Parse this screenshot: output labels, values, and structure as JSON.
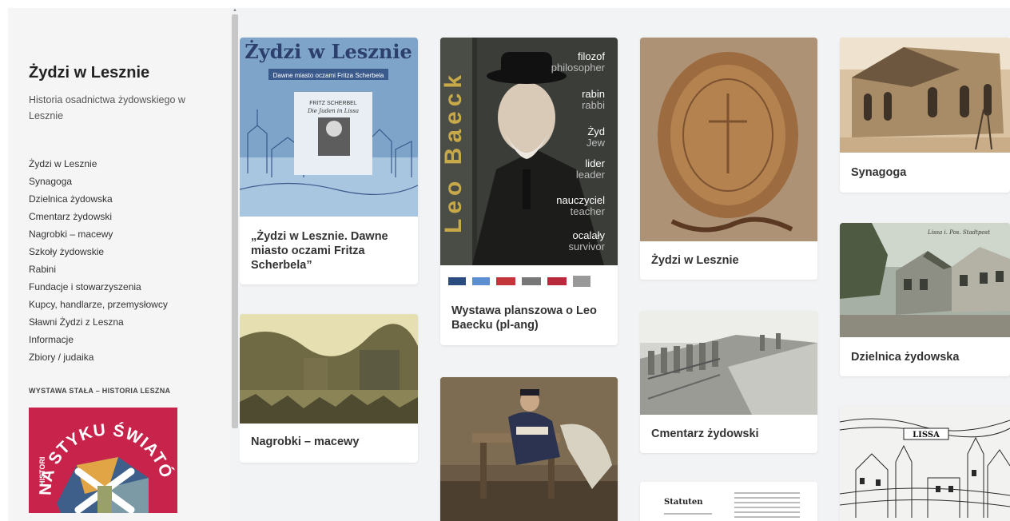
{
  "sidebar": {
    "title": "Żydzi w Lesznie",
    "description": "Historia osadnictwa żydowskiego w Lesznie",
    "nav": [
      "Żydzi w Lesznie",
      "Synagoga",
      "Dzielnica żydowska",
      "Cmentarz żydowski",
      "Nagrobki – macewy",
      "Szkoły żydowskie",
      "Rabini",
      "Fundacje i stowarzyszenia",
      "Kupcy, handlarze, przemysłowcy",
      "Sławni Żydzi z Leszna",
      "Informacje",
      "Zbiory / judaika"
    ],
    "section_label": "WYSTAWA STAŁA – HISTORIA LESZNA",
    "promo_text": "NA STYKU ŚWIATÓW",
    "promo_side_text": "HISTORI",
    "promo_color": "#c8234b"
  },
  "cards": {
    "book": {
      "caption": "„Żydzi w Lesznie. Dawne miasto oczami Fritza Scherbela”",
      "cover_title": "Żydzi w Lesznie",
      "cover_subtitle": "Dawne miasto oczami Fritza Scherbela",
      "cover_author": "FRITZ SCHERBEL",
      "cover_script": "Die Juden in Lissa"
    },
    "baeck": {
      "caption": "Wystawa planszowa o Leo Baecku (pl-ang)",
      "vertical_name": "Leo Baeck",
      "roles": [
        {
          "pl": "filozof",
          "en": "philosopher"
        },
        {
          "pl": "rabin",
          "en": "rabbi"
        },
        {
          "pl": "Żyd",
          "en": "Jew"
        },
        {
          "pl": "lider",
          "en": "leader"
        },
        {
          "pl": "nauczyciel",
          "en": "teacher"
        },
        {
          "pl": "ocalały",
          "en": "survivor"
        }
      ]
    },
    "seal": {
      "caption": "Żydzi w Lesznie"
    },
    "synagogue": {
      "caption": "Synagoga"
    },
    "district": {
      "caption": "Dzielnica żydowska",
      "postcard_text": "Lissa i. Pos.  Stadtpost"
    },
    "cemetery": {
      "caption": "Cmentarz żydowski"
    },
    "tombstones": {
      "caption": "Nagrobki – macewy"
    },
    "scholar": {
      "caption": ""
    },
    "statute": {
      "caption": "",
      "doc_title": "Statuten"
    },
    "engraving": {
      "caption": "",
      "banner_text": "LISSA"
    }
  },
  "colors": {
    "main_bg": "#f2f3f5",
    "sidebar_bg": "#f5f5f5",
    "card_bg": "#ffffff"
  }
}
